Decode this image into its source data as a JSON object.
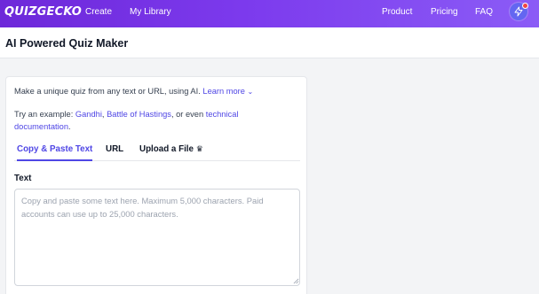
{
  "app": {
    "logo_text": "QUIZGECKO"
  },
  "nav": {
    "left": [
      "Create",
      "My Library"
    ],
    "right": [
      "Product",
      "Pricing",
      "FAQ"
    ]
  },
  "page": {
    "title": "AI Powered Quiz Maker"
  },
  "intro": {
    "text": "Make a unique quiz from any text or URL, using AI.",
    "learn_more": "Learn more"
  },
  "example": {
    "prefix": "Try an example:",
    "link1": "Gandhi",
    "sep1": ",",
    "link2": "Battle of Hastings",
    "sep2": ", or even",
    "link3": "technical documentation",
    "suffix": "."
  },
  "tabs": [
    {
      "label": "Copy & Paste Text",
      "active": true
    },
    {
      "label": "URL",
      "active": false
    },
    {
      "label": "Upload a File",
      "active": false,
      "icon": "crown-icon"
    }
  ],
  "text_field": {
    "label": "Text",
    "value": "",
    "placeholder": "Copy and paste some text here. Maximum 5,000 characters. Paid accounts can use up to 25,000 characters."
  },
  "colors": {
    "nav_gradient_start": "#6d28d9",
    "nav_gradient_end": "#8b5cf6",
    "accent": "#4f46e5",
    "notification": "#ef4444"
  }
}
